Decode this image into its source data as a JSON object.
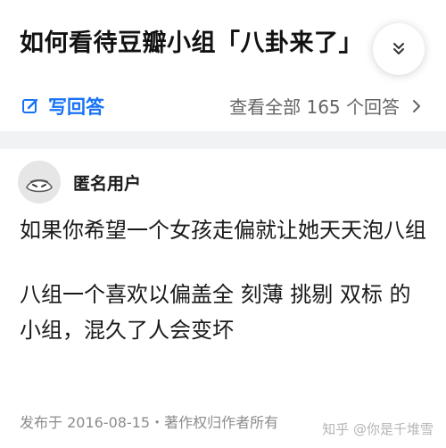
{
  "question": {
    "title": "如何看待豆瓣小组「八卦来了」"
  },
  "actions": {
    "write_answer": "写回答",
    "view_all": "查看全部 165 个回答"
  },
  "answer": {
    "author": "匿名用户",
    "paragraphs": [
      "如果你希望一个女孩走偏就让她天天泡八组",
      "八组一个喜欢以偏盖全 刻薄 挑剔 双标 的小组，混久了人会变坏"
    ],
    "meta": "发布于 2016-08-15・著作权归作者所有"
  },
  "watermark": "知乎 @你是千堆雪",
  "colors": {
    "accent": "#1772f6",
    "divider": "#f1f2f4",
    "secondary_text": "#8c8c8c"
  },
  "icons": {
    "expand": "chevron-double-down-icon",
    "write": "edit-icon",
    "view_all": "chevron-right-icon"
  }
}
